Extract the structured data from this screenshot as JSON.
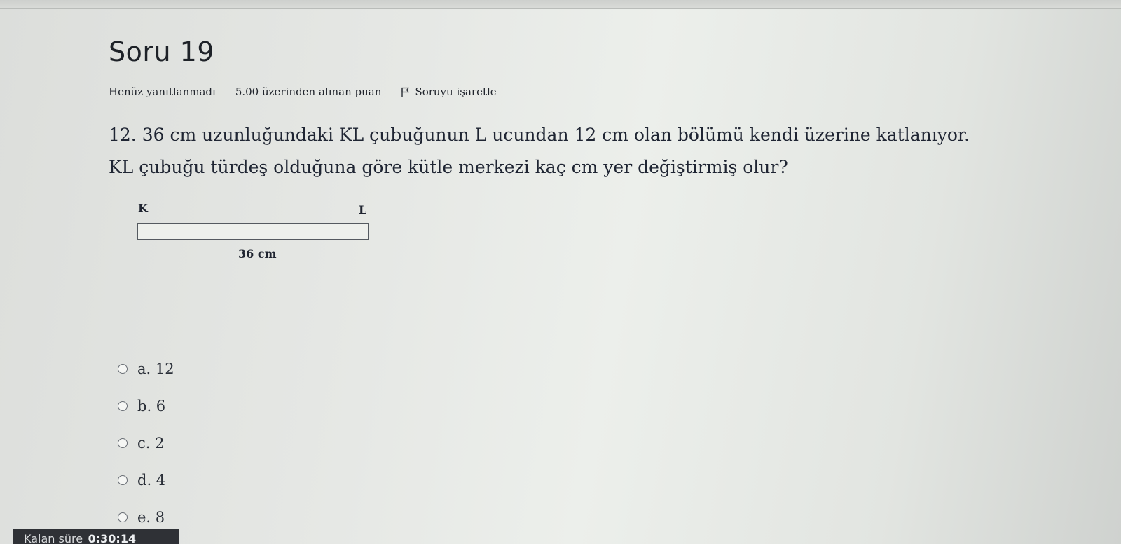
{
  "question": {
    "title": "Soru 19",
    "status": "Henüz yanıtlanmadı",
    "points": "5.00 üzerinden alınan puan",
    "flag_label": "Soruyu işaretle",
    "text": "12. 36 cm uzunluğundaki KL çubuğunun L ucundan 12 cm olan bölümü kendi üzerine katlanıyor. KL çubuğu türdeş olduğuna göre kütle merkezi kaç cm yer değiştirmiş olur?"
  },
  "figure": {
    "label_k": "K",
    "label_l": "L",
    "length_label": "36 cm"
  },
  "options": [
    {
      "label": "a. 12"
    },
    {
      "label": "b. 6"
    },
    {
      "label": "c. 2"
    },
    {
      "label": "d. 4"
    },
    {
      "label": "e. 8"
    }
  ],
  "timer": {
    "label": "Kalan süre",
    "value": "0:30:14"
  },
  "icons": {
    "flag": "flag-icon",
    "radio": "radio-button-icon"
  }
}
